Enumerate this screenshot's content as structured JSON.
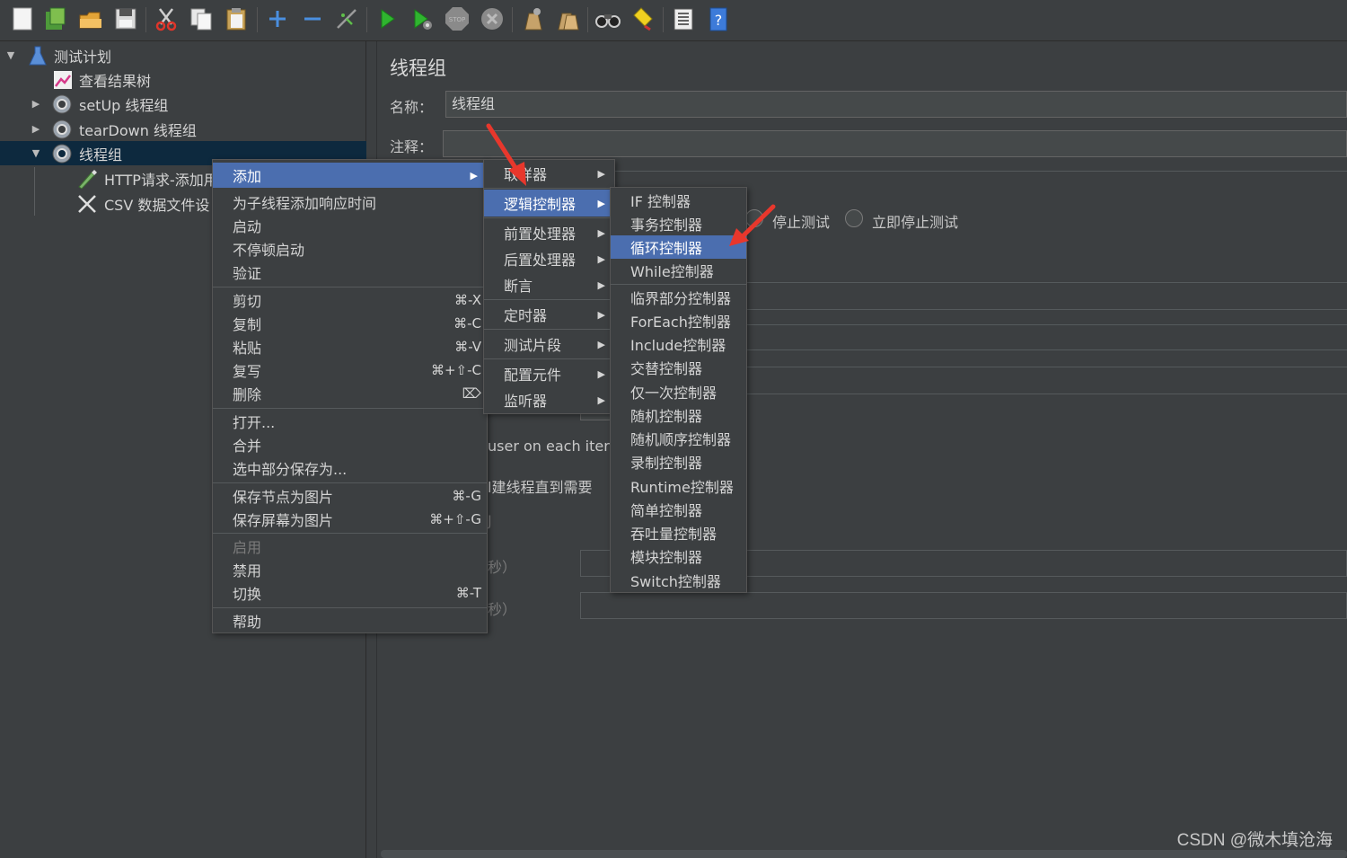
{
  "toolbar": {
    "icons": [
      "new-icon",
      "templates-icon",
      "open-icon",
      "save-icon",
      "cut-icon",
      "copy-icon",
      "paste-icon",
      "expand-icon",
      "collapse-icon",
      "toggle-icon",
      "start-icon",
      "start-no-pause-icon",
      "stop-icon",
      "shutdown-icon",
      "clear-icon",
      "clear-all-icon",
      "search-icon",
      "reset-search-icon",
      "function-helper-icon",
      "help-icon"
    ]
  },
  "tree": {
    "items": [
      {
        "label": "测试计划",
        "icon": "flask-icon"
      },
      {
        "label": "查看结果树",
        "icon": "chart-icon"
      },
      {
        "label": "setUp 线程组",
        "icon": "gear-icon"
      },
      {
        "label": "tearDown 线程组",
        "icon": "gear-icon"
      },
      {
        "label": "线程组",
        "icon": "gear-icon"
      },
      {
        "label": "HTTP请求-添加用",
        "icon": "pen-icon"
      },
      {
        "label": "CSV 数据文件设",
        "icon": "scissors-icon"
      }
    ]
  },
  "panel": {
    "title": "线程组",
    "name_label": "名称：",
    "name_value": "线程组",
    "comment_label": "注释：",
    "comment_value": "",
    "radio_stop_test": "停止测试",
    "radio_stop_now": "立即停止测试",
    "same_user_text": "user on each iterat",
    "delay_thread_text": "l建线程直到需要",
    "seconds_1": "秒）",
    "seconds_2": "秒）",
    "partial_char": "J"
  },
  "context_menu": {
    "items": [
      {
        "label": "添加",
        "shortcut": "",
        "submenu": true,
        "highlighted": true
      },
      {
        "label": "为子线程添加响应时间",
        "shortcut": ""
      },
      {
        "label": "启动",
        "shortcut": ""
      },
      {
        "label": "不停顿启动",
        "shortcut": ""
      },
      {
        "label": "验证",
        "shortcut": ""
      },
      {
        "label": "剪切",
        "shortcut": "⌘-X"
      },
      {
        "label": "复制",
        "shortcut": "⌘-C"
      },
      {
        "label": "粘贴",
        "shortcut": "⌘-V"
      },
      {
        "label": "复写",
        "shortcut": "⌘+⇧-C"
      },
      {
        "label": "删除",
        "shortcut": "⌦"
      },
      {
        "label": "打开...",
        "shortcut": ""
      },
      {
        "label": "合并",
        "shortcut": ""
      },
      {
        "label": "选中部分保存为...",
        "shortcut": ""
      },
      {
        "label": "保存节点为图片",
        "shortcut": "⌘-G"
      },
      {
        "label": "保存屏幕为图片",
        "shortcut": "⌘+⇧-G"
      },
      {
        "label": "启用",
        "shortcut": "",
        "disabled": true
      },
      {
        "label": "禁用",
        "shortcut": ""
      },
      {
        "label": "切换",
        "shortcut": "⌘-T"
      },
      {
        "label": "帮助",
        "shortcut": ""
      }
    ]
  },
  "add_submenu": {
    "items": [
      {
        "label": "取样器"
      },
      {
        "label": "逻辑控制器",
        "highlighted": true
      },
      {
        "label": "前置处理器"
      },
      {
        "label": "后置处理器"
      },
      {
        "label": "断言"
      },
      {
        "label": "定时器"
      },
      {
        "label": "测试片段"
      },
      {
        "label": "配置元件"
      },
      {
        "label": "监听器"
      }
    ]
  },
  "logic_submenu": {
    "items": [
      {
        "label": "IF 控制器"
      },
      {
        "label": "事务控制器"
      },
      {
        "label": "循环控制器",
        "highlighted": true
      },
      {
        "label": "While控制器"
      },
      {
        "label": "临界部分控制器"
      },
      {
        "label": "ForEach控制器"
      },
      {
        "label": "Include控制器"
      },
      {
        "label": "交替控制器"
      },
      {
        "label": "仅一次控制器"
      },
      {
        "label": "随机控制器"
      },
      {
        "label": "随机顺序控制器"
      },
      {
        "label": "录制控制器"
      },
      {
        "label": "Runtime控制器"
      },
      {
        "label": "简单控制器"
      },
      {
        "label": "吞吐量控制器"
      },
      {
        "label": "模块控制器"
      },
      {
        "label": "Switch控制器"
      }
    ]
  },
  "watermark": "CSDN @微木填沧海",
  "colors": {
    "background": "#3c3f41",
    "selection": "#0d293e",
    "menu_highlight": "#4b6eaf",
    "annotation_arrow": "#e8372c"
  }
}
